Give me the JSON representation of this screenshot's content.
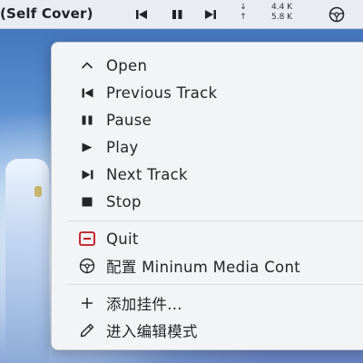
{
  "panel": {
    "title": "(Self Cover)",
    "net_up": "4.4 K",
    "net_down": "5.8 K",
    "buttons": [
      "previous-track-icon",
      "pause-icon",
      "next-track-icon"
    ],
    "net_arrow_icons": [
      "arrow-down-icon",
      "arrow-up-icon"
    ]
  },
  "menu": {
    "items": [
      {
        "label": "Open",
        "icon": "chevron-up-icon"
      },
      {
        "label": "Previous Track",
        "icon": "previous-track-icon"
      },
      {
        "label": "Pause",
        "icon": "pause-icon"
      },
      {
        "label": "Play",
        "icon": "play-icon"
      },
      {
        "label": "Next Track",
        "icon": "next-track-icon"
      },
      {
        "label": "Stop",
        "icon": "stop-icon"
      },
      {
        "label": "Quit",
        "icon": "quit-icon"
      },
      {
        "label": "配置 Mininum Media Cont",
        "icon": "settings-icon"
      },
      {
        "label": "添加挂件...",
        "icon": "plus-icon"
      },
      {
        "label": "进入编辑模式",
        "icon": "pencil-icon"
      }
    ]
  },
  "colors": {
    "panel_bg": "#e9ecf1",
    "menu_bg": "#f3f4f6",
    "text": "#232629",
    "quit_red": "#c0141c"
  }
}
